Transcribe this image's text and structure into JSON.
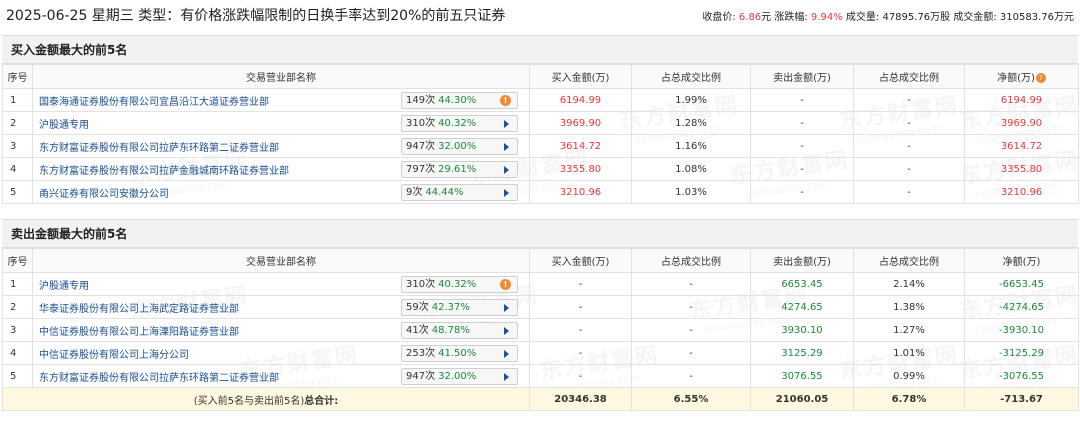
{
  "header": {
    "title": "2025-06-25 星期三 类型：有价格涨跌幅限制的日换手率达到20%的前五只证券",
    "close_label": "收盘价: ",
    "close_value": "6.86",
    "close_unit": "元",
    "change_label": "涨跌幅: ",
    "change_value": "9.94%",
    "volume_label": "成交量: ",
    "volume_value": "47895.76万股",
    "amount_label": "成交金额: ",
    "amount_value": "310583.76万元"
  },
  "buy_section": {
    "title": "买入金额最大的前5名",
    "columns": [
      "序号",
      "交易营业部名称",
      "买入金额(万)",
      "占总成交比例",
      "卖出金额(万)",
      "占总成交比例",
      "净额(万)"
    ],
    "net_icon": "?",
    "rows": [
      {
        "idx": "1",
        "name": "国泰海通证券股份有限公司宜昌沿江大道证券营业部",
        "count": "149次",
        "pct": "44.30%",
        "buy": "6194.99",
        "buy_ratio": "1.99%",
        "sell": "-",
        "sell_ratio": "-",
        "net": "6194.99"
      },
      {
        "idx": "2",
        "name": "沪股通专用",
        "count": "310次",
        "pct": "40.32%",
        "buy": "3969.90",
        "buy_ratio": "1.28%",
        "sell": "-",
        "sell_ratio": "-",
        "net": "3969.90"
      },
      {
        "idx": "3",
        "name": "东方财富证券股份有限公司拉萨东环路第二证券营业部",
        "count": "947次",
        "pct": "32.00%",
        "buy": "3614.72",
        "buy_ratio": "1.16%",
        "sell": "-",
        "sell_ratio": "-",
        "net": "3614.72"
      },
      {
        "idx": "4",
        "name": "东方财富证券股份有限公司拉萨金融城南环路证券营业部",
        "count": "797次",
        "pct": "29.61%",
        "buy": "3355.80",
        "buy_ratio": "1.08%",
        "sell": "-",
        "sell_ratio": "-",
        "net": "3355.80"
      },
      {
        "idx": "5",
        "name": "甬兴证券有限公司安徽分公司",
        "count": "9次",
        "pct": "44.44%",
        "buy": "3210.96",
        "buy_ratio": "1.03%",
        "sell": "-",
        "sell_ratio": "-",
        "net": "3210.96"
      }
    ]
  },
  "sell_section": {
    "title": "卖出金额最大的前5名",
    "columns": [
      "序号",
      "交易营业部名称",
      "买入金额(万)",
      "占总成交比例",
      "卖出金额(万)",
      "占总成交比例",
      "净额(万)"
    ],
    "rows": [
      {
        "idx": "1",
        "name": "沪股通专用",
        "count": "310次",
        "pct": "40.32%",
        "buy": "-",
        "buy_ratio": "-",
        "sell": "6653.45",
        "sell_ratio": "2.14%",
        "net": "-6653.45"
      },
      {
        "idx": "2",
        "name": "华泰证券股份有限公司上海武定路证券营业部",
        "count": "59次",
        "pct": "42.37%",
        "buy": "-",
        "buy_ratio": "-",
        "sell": "4274.65",
        "sell_ratio": "1.38%",
        "net": "-4274.65"
      },
      {
        "idx": "3",
        "name": "中信证券股份有限公司上海溧阳路证券营业部",
        "count": "41次",
        "pct": "48.78%",
        "buy": "-",
        "buy_ratio": "-",
        "sell": "3930.10",
        "sell_ratio": "1.27%",
        "net": "-3930.10"
      },
      {
        "idx": "4",
        "name": "中信证券股份有限公司上海分公司",
        "count": "253次",
        "pct": "41.50%",
        "buy": "-",
        "buy_ratio": "-",
        "sell": "3125.29",
        "sell_ratio": "1.01%",
        "net": "-3125.29"
      },
      {
        "idx": "5",
        "name": "东方财富证券股份有限公司拉萨东环路第二证券营业部",
        "count": "947次",
        "pct": "32.00%",
        "buy": "-",
        "buy_ratio": "-",
        "sell": "3076.55",
        "sell_ratio": "0.99%",
        "net": "-3076.55"
      }
    ],
    "summary": {
      "label_prefix": "(买入前5名与卖出前5名)",
      "label_bold": "总合计:",
      "buy": "20346.38",
      "buy_ratio": "6.55%",
      "sell": "21060.05",
      "sell_ratio": "6.78%",
      "net": "-713.67"
    }
  },
  "watermark": {
    "cn": "东方财富网",
    "en": "eastmoney.com"
  },
  "colors": {
    "up": "#e4393c",
    "down": "#1b8a3c",
    "link": "#1a4e8f",
    "summary_bg": "#fdf8df"
  }
}
